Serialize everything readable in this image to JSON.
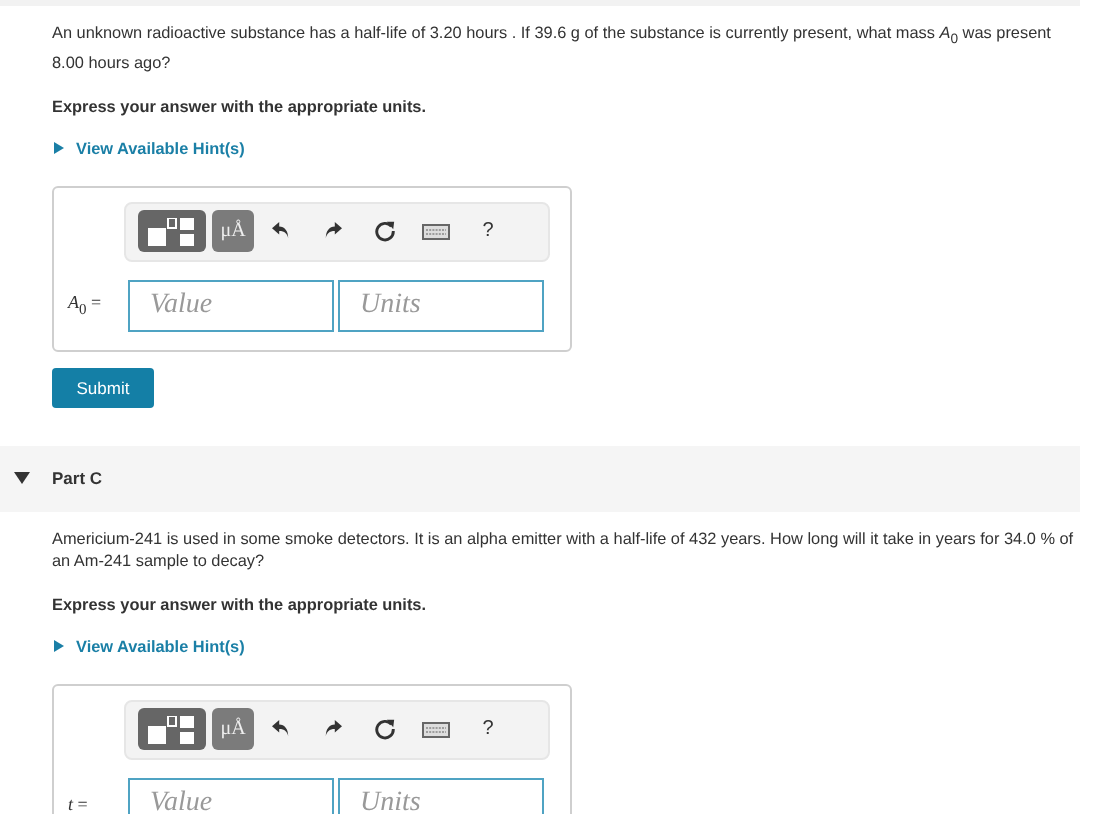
{
  "sections": [
    {
      "kind": "question",
      "text": "An unknown radioactive substance has a half-life of 3.20 hours . If  39.6 g of the substance is currently present, what mass *A*$_{0}$ was present 8.00 hours ago?",
      "instruction": "Express your answer with the appropriate units.",
      "hint": {
        "label": "View Available Hint(s)",
        "expanded": false
      },
      "answer": {
        "label": "*A*$_{0}$ =",
        "toolbar": [
          {
            "kind": "template"
          },
          {
            "kind": "units",
            "label": "μÅ"
          },
          {
            "kind": "undo"
          },
          {
            "kind": "redo"
          },
          {
            "kind": "reset"
          },
          {
            "kind": "keyboard"
          },
          {
            "kind": "help",
            "label": "?"
          }
        ],
        "value_placeholder": "Value",
        "units_placeholder": "Units"
      },
      "submit": "Submit"
    },
    {
      "kind": "part",
      "title": "Part C",
      "expanded": true,
      "text": "Americium-241 is used in some smoke detectors. It is an alpha emitter with a  half-life of 432 years. How long will it take in years for 34.0 % of an Am-241 sample to decay?",
      "instruction": "Express your answer with the appropriate units.",
      "hint": {
        "label": "View Available Hint(s)",
        "expanded": false
      },
      "answer": {
        "label": "*t* =",
        "toolbar": [
          {
            "kind": "template"
          },
          {
            "kind": "units",
            "label": "μÅ"
          },
          {
            "kind": "undo"
          },
          {
            "kind": "redo"
          },
          {
            "kind": "reset"
          },
          {
            "kind": "keyboard"
          },
          {
            "kind": "help",
            "label": "?"
          }
        ],
        "value_placeholder": "Value",
        "units_placeholder": "Units"
      }
    }
  ]
}
